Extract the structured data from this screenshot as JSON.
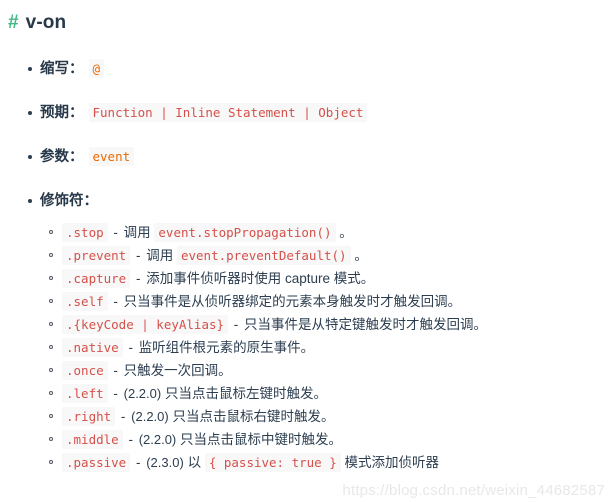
{
  "heading": {
    "anchor": "#",
    "title": "v-on",
    "anchor_color": "#42b983"
  },
  "colors": {
    "body_text": "#2c3e50",
    "code_text": "#e96900",
    "code_bg": "#f8f8f8",
    "accent_green": "#42b983"
  },
  "entries": [
    {
      "label": "缩写",
      "colon": "：",
      "code": "@"
    },
    {
      "label": "预期",
      "colon": "：",
      "code": "Function | Inline Statement | Object"
    },
    {
      "label": "参数",
      "colon": "：",
      "code": "event"
    },
    {
      "label": "修饰符",
      "colon": "："
    }
  ],
  "modifiers": [
    {
      "name": ".stop",
      "dash": "-",
      "parts": [
        {
          "type": "text",
          "value": "调用"
        },
        {
          "type": "code",
          "value": "event.stopPropagation()"
        },
        {
          "type": "text",
          "value": "。"
        }
      ]
    },
    {
      "name": ".prevent",
      "dash": "-",
      "parts": [
        {
          "type": "text",
          "value": "调用"
        },
        {
          "type": "code",
          "value": "event.preventDefault()"
        },
        {
          "type": "text",
          "value": "。"
        }
      ]
    },
    {
      "name": ".capture",
      "dash": "-",
      "parts": [
        {
          "type": "text",
          "value": "添加事件侦听器时使用 capture 模式。"
        }
      ]
    },
    {
      "name": ".self",
      "dash": "-",
      "parts": [
        {
          "type": "text",
          "value": "只当事件是从侦听器绑定的元素本身触发时才触发回调。"
        }
      ]
    },
    {
      "name": ".{keyCode | keyAlias}",
      "dash": "-",
      "parts": [
        {
          "type": "text",
          "value": "只当事件是从特定键触发时才触发回调。"
        }
      ]
    },
    {
      "name": ".native",
      "dash": "-",
      "parts": [
        {
          "type": "text",
          "value": "监听组件根元素的原生事件。"
        }
      ]
    },
    {
      "name": ".once",
      "dash": "-",
      "parts": [
        {
          "type": "text",
          "value": "只触发一次回调。"
        }
      ]
    },
    {
      "name": ".left",
      "dash": "-",
      "parts": [
        {
          "type": "version",
          "value": "(2.2.0)"
        },
        {
          "type": "text",
          "value": "只当点击鼠标左键时触发。"
        }
      ]
    },
    {
      "name": ".right",
      "dash": "-",
      "parts": [
        {
          "type": "version",
          "value": "(2.2.0)"
        },
        {
          "type": "text",
          "value": "只当点击鼠标右键时触发。"
        }
      ]
    },
    {
      "name": ".middle",
      "dash": "-",
      "parts": [
        {
          "type": "version",
          "value": "(2.2.0)"
        },
        {
          "type": "text",
          "value": "只当点击鼠标中键时触发。"
        }
      ]
    },
    {
      "name": ".passive",
      "dash": "-",
      "parts": [
        {
          "type": "version",
          "value": "(2.3.0)"
        },
        {
          "type": "text",
          "value": "以"
        },
        {
          "type": "code",
          "value": "{ passive: true }"
        },
        {
          "type": "text",
          "value": "模式添加侦听器"
        }
      ]
    }
  ],
  "watermark": "https://blog.csdn.net/weixin_44682587"
}
